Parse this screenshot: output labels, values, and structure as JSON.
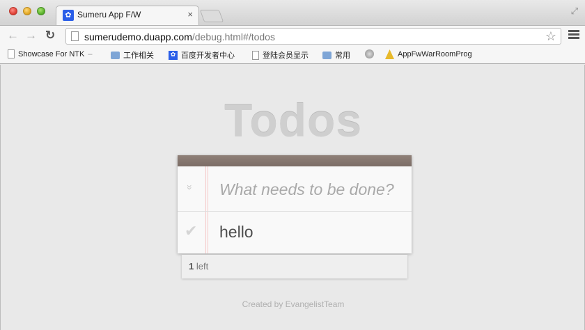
{
  "browser": {
    "tab_title": "Sumeru App F/W",
    "tab_close": "×",
    "url_host": "sumerudemo.duapp.com",
    "url_path": "/debug.html#/todos"
  },
  "bookmarks": [
    {
      "label": "Showcase For NTK",
      "suffix": "–",
      "icon": "page-icon"
    },
    {
      "label": "工作相关",
      "icon": "folder-icon"
    },
    {
      "label": "百度开发者中心",
      "icon": "paw-icon"
    },
    {
      "label": "登陆会员显示",
      "icon": "page-icon"
    },
    {
      "label": "常用",
      "icon": "folder-icon"
    },
    {
      "label": "",
      "icon": "globe-icon"
    },
    {
      "label": "AppFwWarRoomProg",
      "icon": "warning-icon"
    }
  ],
  "app": {
    "title": "Todos",
    "new_todo_placeholder": "What needs to be done?",
    "toggle_all_glyph": "»",
    "todos": [
      {
        "label": "hello",
        "completed": false,
        "check_glyph": "✔"
      }
    ],
    "count": "1",
    "count_suffix": "left",
    "credit": "Created by EvangelistTeam"
  },
  "colors": {
    "header": "#8a7b74",
    "title": "#cfcfcf",
    "background": "#e9e9e9"
  }
}
